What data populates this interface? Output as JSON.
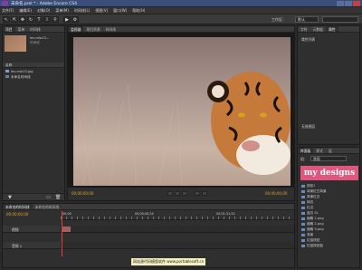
{
  "window": {
    "title": "未命名.prel * - Adobe Encore CS4"
  },
  "menu": [
    "文件(F)",
    "编辑(E)",
    "对象(O)",
    "菜单(M)",
    "时间线(L)",
    "视图(V)",
    "窗口(W)",
    "帮助(H)"
  ],
  "toolbar": {
    "workspace_label": "工作区：",
    "workspace_value": "默认"
  },
  "project_panel": {
    "tabs": [
      "项目",
      "菜单",
      "时间线"
    ],
    "thumb_name": "lev-mio13...",
    "thumb_info": "时间线",
    "items_header": "名称",
    "items": [
      "lev-mio13.jpg",
      "未命名时间线"
    ]
  },
  "monitor": {
    "tabs": [
      "监视器",
      "项目资源",
      "时间线"
    ],
    "timecode_left": "00;00;00;00",
    "timecode_right": "00;00;00;00"
  },
  "properties_panel": {
    "tabs": [
      "字符",
      "元数据",
      "属性"
    ],
    "heading": "属性列表",
    "field_label": "无效图层"
  },
  "library_panel": {
    "tabs": [
      "库面板",
      "样式",
      "层"
    ],
    "set_label": "组：",
    "set_value": "常规",
    "logo_text": "my designs",
    "items": [
      "按钮1",
      "背景红白背景",
      "背景红白",
      "绿边",
      "红边",
      "蓝边 SL",
      "缩略 1.png",
      "缩略 2.png",
      "缩略 3.png",
      "背景",
      "红蓝按钮",
      "红蓝按钮板"
    ]
  },
  "timeline": {
    "tabs": [
      "未命名的时间线",
      "未命名的时间线"
    ],
    "timecode": "00;00;00;00",
    "ruler_marks": [
      "00;00",
      "00;00;45;24",
      "00;01;31;22"
    ],
    "tracks": [
      {
        "name": "视频"
      },
      {
        "name": "音频 1"
      }
    ]
  },
  "watermark": "网站源代码模版软件 www.portablesoft.cn"
}
